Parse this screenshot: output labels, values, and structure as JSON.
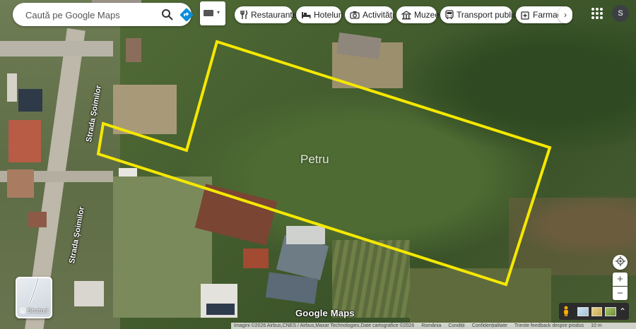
{
  "search": {
    "placeholder": "Caută pe Google Maps"
  },
  "chips": [
    {
      "label": "Restaurante",
      "icon": "fork-knife-icon"
    },
    {
      "label": "Hoteluri",
      "icon": "bed-icon"
    },
    {
      "label": "Activități",
      "icon": "camera-icon"
    },
    {
      "label": "Muzee",
      "icon": "museum-icon"
    },
    {
      "label": "Transport public",
      "icon": "bus-icon"
    },
    {
      "label": "Farmacii",
      "icon": "pharmacy-icon"
    }
  ],
  "account": {
    "initial": "S"
  },
  "map": {
    "place_label": "Petru",
    "streets": [
      "Strada Șoimilor",
      "Strada Șoimilor"
    ],
    "layers_label": "Straturi",
    "logo": "Google Maps",
    "highlight_color": "#f5e800"
  },
  "attribution": {
    "imagery": "Imagini ©2026 Airbus,CNES / Airbus,Maxar Technologies,Date cartografice ©2026",
    "country": "România",
    "terms": "Condiții",
    "privacy": "Confidențialitate",
    "feedback": "Trimite feedback despre produs",
    "scale": "10 m"
  }
}
